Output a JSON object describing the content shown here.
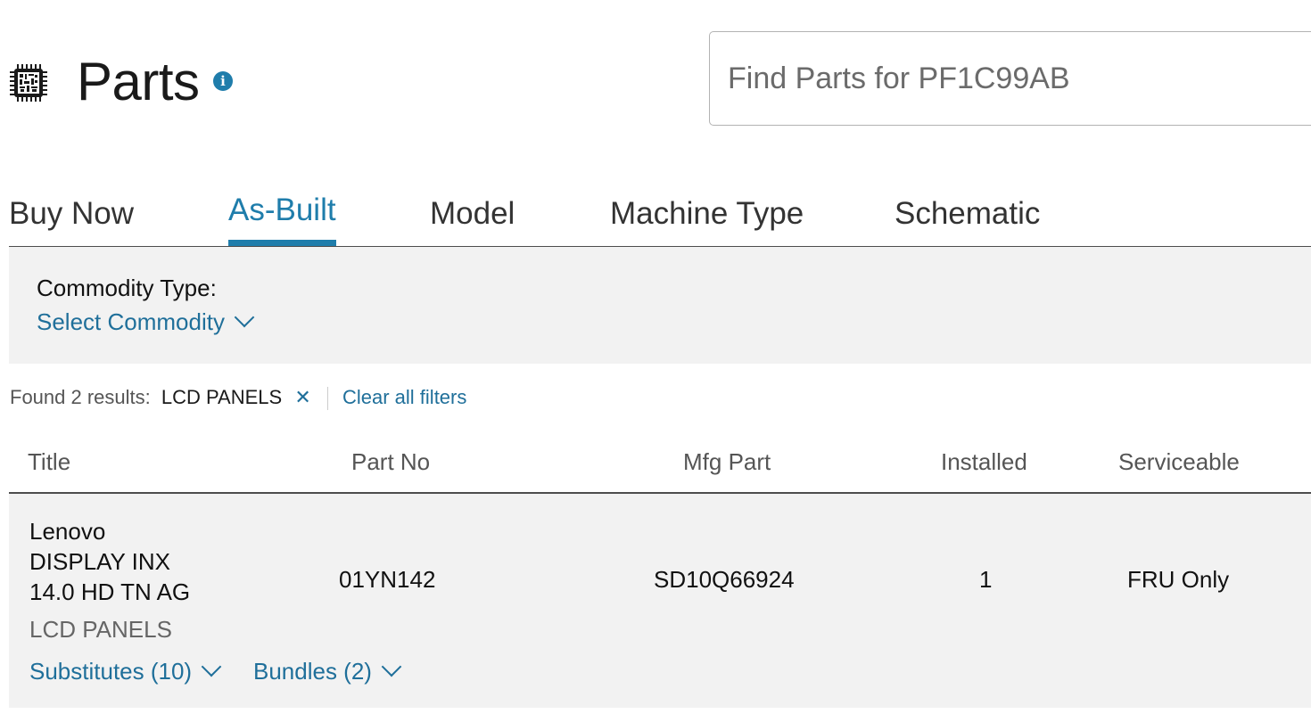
{
  "header": {
    "title": "Parts",
    "title_icon": "chip-icon",
    "info_icon": "info-icon"
  },
  "search": {
    "placeholder": "Find Parts for PF1C99AB",
    "value": ""
  },
  "tabs": [
    {
      "label": "Buy Now",
      "active": false
    },
    {
      "label": "As-Built",
      "active": true
    },
    {
      "label": "Model",
      "active": false
    },
    {
      "label": "Machine Type",
      "active": false
    },
    {
      "label": "Schematic",
      "active": false
    }
  ],
  "filter": {
    "label": "Commodity Type:",
    "select_label": "Select Commodity"
  },
  "results": {
    "count_text": "Found 2 results:",
    "active_filter": "LCD PANELS",
    "remove_glyph": "✕",
    "clear_label": "Clear all filters"
  },
  "table": {
    "columns": [
      "Title",
      "Part No",
      "Mfg Part",
      "Installed",
      "Serviceable"
    ],
    "rows": [
      {
        "title_lines": [
          "Lenovo",
          "DISPLAY INX",
          "14.0 HD TN AG"
        ],
        "category": "LCD PANELS",
        "part_no": "01YN142",
        "mfg_part": "SD10Q66924",
        "installed": "1",
        "serviceable": "FRU Only",
        "substitutes_label": "Substitutes (10)",
        "bundles_label": "Bundles (2)"
      }
    ]
  },
  "colors": {
    "accent": "#1f7dab",
    "link": "#1f6f9a",
    "panel_bg": "#f2f2f2"
  }
}
